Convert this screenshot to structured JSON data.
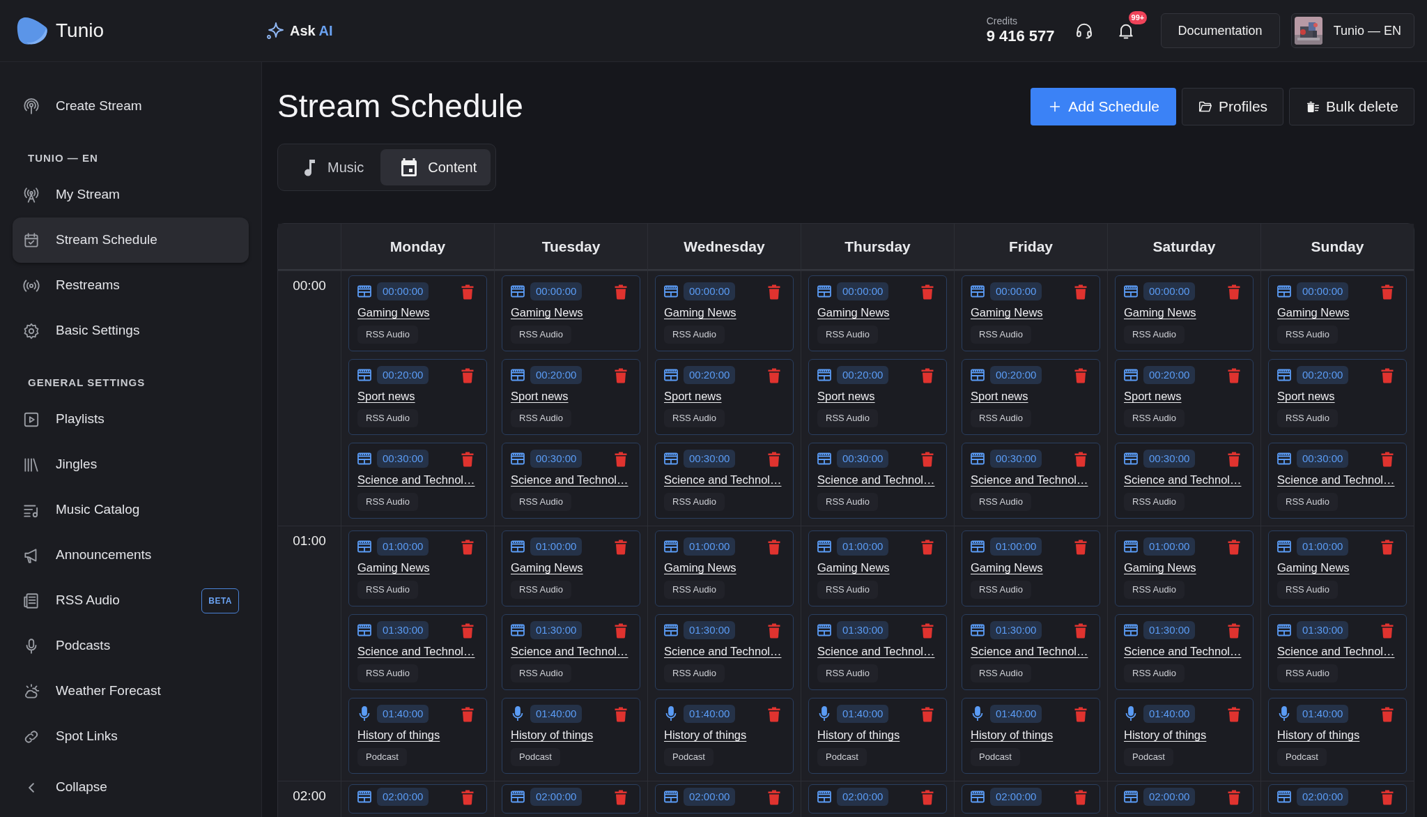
{
  "topbar": {
    "brand": "Tunio",
    "ask": {
      "label": "Ask",
      "highlight": "AI"
    },
    "credits": {
      "label": "Credits",
      "value": "9 416 577"
    },
    "notifications": {
      "badge": "99+"
    },
    "documentation": "Documentation",
    "profile": {
      "name": "Tunio — EN"
    }
  },
  "sidebar": {
    "items": [
      {
        "label": "Create Stream",
        "selected": false
      }
    ],
    "sections": [
      {
        "title": "TUNIO — EN",
        "items": [
          {
            "label": "My Stream",
            "selected": false
          },
          {
            "label": "Stream Schedule",
            "selected": true
          },
          {
            "label": "Restreams",
            "selected": false
          },
          {
            "label": "Basic Settings",
            "selected": false
          }
        ]
      },
      {
        "title": "GENERAL SETTINGS",
        "items": [
          {
            "label": "Playlists",
            "selected": false
          },
          {
            "label": "Jingles",
            "selected": false
          },
          {
            "label": "Music Catalog",
            "selected": false
          },
          {
            "label": "Announcements",
            "selected": false
          },
          {
            "label": "RSS Audio",
            "selected": false,
            "badge": "BETA"
          },
          {
            "label": "Podcasts",
            "selected": false
          },
          {
            "label": "Weather Forecast",
            "selected": false
          },
          {
            "label": "Spot Links",
            "selected": false
          }
        ]
      }
    ],
    "collapse": "Collapse"
  },
  "page": {
    "title": "Stream Schedule",
    "actions": [
      {
        "label": "Add Schedule",
        "kind": "primary"
      },
      {
        "label": "Profiles",
        "kind": "secondary"
      },
      {
        "label": "Bulk delete",
        "kind": "secondary"
      }
    ],
    "tabs": [
      {
        "label": "Music",
        "selected": false
      },
      {
        "label": "Content",
        "selected": true
      }
    ]
  },
  "schedule": {
    "days": [
      "Monday",
      "Tuesday",
      "Wednesday",
      "Thursday",
      "Friday",
      "Saturday",
      "Sunday"
    ],
    "hours": [
      {
        "time": "00:00",
        "days": [
          [
            {
              "kind": "rss",
              "time": "00:00:00",
              "title": "Gaming News",
              "source": "RSS Audio"
            },
            {
              "kind": "rss",
              "time": "00:20:00",
              "title": "Sport news",
              "source": "RSS Audio"
            },
            {
              "kind": "rss",
              "time": "00:30:00",
              "title": "Science and Technol…",
              "source": "RSS Audio"
            }
          ],
          [
            {
              "kind": "rss",
              "time": "00:00:00",
              "title": "Gaming News",
              "source": "RSS Audio"
            },
            {
              "kind": "rss",
              "time": "00:20:00",
              "title": "Sport news",
              "source": "RSS Audio"
            },
            {
              "kind": "rss",
              "time": "00:30:00",
              "title": "Science and Technol…",
              "source": "RSS Audio"
            }
          ],
          [
            {
              "kind": "rss",
              "time": "00:00:00",
              "title": "Gaming News",
              "source": "RSS Audio"
            },
            {
              "kind": "rss",
              "time": "00:20:00",
              "title": "Sport news",
              "source": "RSS Audio"
            },
            {
              "kind": "rss",
              "time": "00:30:00",
              "title": "Science and Technol…",
              "source": "RSS Audio"
            }
          ],
          [
            {
              "kind": "rss",
              "time": "00:00:00",
              "title": "Gaming News",
              "source": "RSS Audio"
            },
            {
              "kind": "rss",
              "time": "00:20:00",
              "title": "Sport news",
              "source": "RSS Audio"
            },
            {
              "kind": "rss",
              "time": "00:30:00",
              "title": "Science and Technol…",
              "source": "RSS Audio"
            }
          ],
          [
            {
              "kind": "rss",
              "time": "00:00:00",
              "title": "Gaming News",
              "source": "RSS Audio"
            },
            {
              "kind": "rss",
              "time": "00:20:00",
              "title": "Sport news",
              "source": "RSS Audio"
            },
            {
              "kind": "rss",
              "time": "00:30:00",
              "title": "Science and Technol…",
              "source": "RSS Audio"
            }
          ],
          [
            {
              "kind": "rss",
              "time": "00:00:00",
              "title": "Gaming News",
              "source": "RSS Audio"
            },
            {
              "kind": "rss",
              "time": "00:20:00",
              "title": "Sport news",
              "source": "RSS Audio"
            },
            {
              "kind": "rss",
              "time": "00:30:00",
              "title": "Science and Technol…",
              "source": "RSS Audio"
            }
          ],
          [
            {
              "kind": "rss",
              "time": "00:00:00",
              "title": "Gaming News",
              "source": "RSS Audio"
            },
            {
              "kind": "rss",
              "time": "00:20:00",
              "title": "Sport news",
              "source": "RSS Audio"
            },
            {
              "kind": "rss",
              "time": "00:30:00",
              "title": "Science and Technol…",
              "source": "RSS Audio"
            }
          ]
        ]
      },
      {
        "time": "01:00",
        "days": [
          [
            {
              "kind": "rss",
              "time": "01:00:00",
              "title": "Gaming News",
              "source": "RSS Audio"
            },
            {
              "kind": "rss",
              "time": "01:30:00",
              "title": "Science and Technol…",
              "source": "RSS Audio"
            },
            {
              "kind": "podcast",
              "time": "01:40:00",
              "title": "History of things",
              "source": "Podcast"
            }
          ],
          [
            {
              "kind": "rss",
              "time": "01:00:00",
              "title": "Gaming News",
              "source": "RSS Audio"
            },
            {
              "kind": "rss",
              "time": "01:30:00",
              "title": "Science and Technol…",
              "source": "RSS Audio"
            },
            {
              "kind": "podcast",
              "time": "01:40:00",
              "title": "History of things",
              "source": "Podcast"
            }
          ],
          [
            {
              "kind": "rss",
              "time": "01:00:00",
              "title": "Gaming News",
              "source": "RSS Audio"
            },
            {
              "kind": "rss",
              "time": "01:30:00",
              "title": "Science and Technol…",
              "source": "RSS Audio"
            },
            {
              "kind": "podcast",
              "time": "01:40:00",
              "title": "History of things",
              "source": "Podcast"
            }
          ],
          [
            {
              "kind": "rss",
              "time": "01:00:00",
              "title": "Gaming News",
              "source": "RSS Audio"
            },
            {
              "kind": "rss",
              "time": "01:30:00",
              "title": "Science and Technol…",
              "source": "RSS Audio"
            },
            {
              "kind": "podcast",
              "time": "01:40:00",
              "title": "History of things",
              "source": "Podcast"
            }
          ],
          [
            {
              "kind": "rss",
              "time": "01:00:00",
              "title": "Gaming News",
              "source": "RSS Audio"
            },
            {
              "kind": "rss",
              "time": "01:30:00",
              "title": "Science and Technol…",
              "source": "RSS Audio"
            },
            {
              "kind": "podcast",
              "time": "01:40:00",
              "title": "History of things",
              "source": "Podcast"
            }
          ],
          [
            {
              "kind": "rss",
              "time": "01:00:00",
              "title": "Gaming News",
              "source": "RSS Audio"
            },
            {
              "kind": "rss",
              "time": "01:30:00",
              "title": "Science and Technol…",
              "source": "RSS Audio"
            },
            {
              "kind": "podcast",
              "time": "01:40:00",
              "title": "History of things",
              "source": "Podcast"
            }
          ],
          [
            {
              "kind": "rss",
              "time": "01:00:00",
              "title": "Gaming News",
              "source": "RSS Audio"
            },
            {
              "kind": "rss",
              "time": "01:30:00",
              "title": "Science and Technol…",
              "source": "RSS Audio"
            },
            {
              "kind": "podcast",
              "time": "01:40:00",
              "title": "History of things",
              "source": "Podcast"
            }
          ]
        ]
      },
      {
        "time": "02:00",
        "days": [
          [
            {
              "kind": "rss",
              "time": "02:00:00"
            }
          ],
          [
            {
              "kind": "rss",
              "time": "02:00:00"
            }
          ],
          [
            {
              "kind": "rss",
              "time": "02:00:00"
            }
          ],
          [
            {
              "kind": "rss",
              "time": "02:00:00"
            }
          ],
          [
            {
              "kind": "rss",
              "time": "02:00:00"
            }
          ],
          [
            {
              "kind": "rss",
              "time": "02:00:00"
            }
          ],
          [
            {
              "kind": "rss",
              "time": "02:00:00"
            }
          ]
        ]
      }
    ]
  }
}
